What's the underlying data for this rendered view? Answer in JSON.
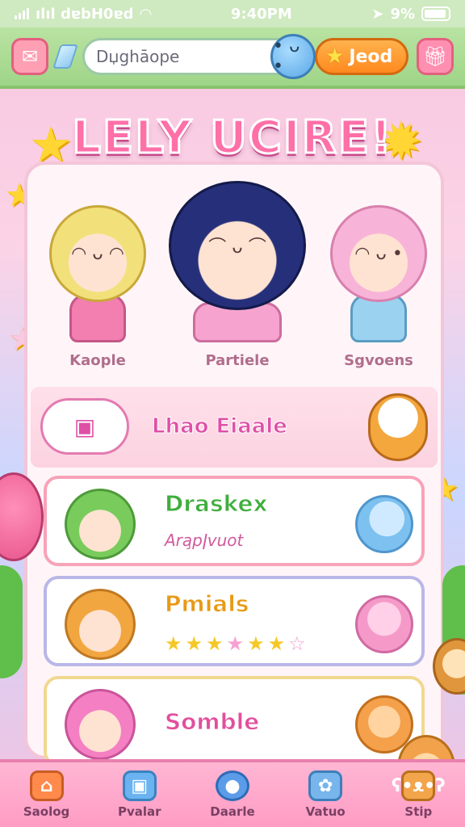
{
  "status_bar": {
    "carrier": "ılıl dɐbH0ɐd",
    "time": "9:40PM",
    "battery_percent": "9%",
    "icons": [
      "signal-icon",
      "wifi-icon",
      "location-icon",
      "battery-icon"
    ]
  },
  "top_bar": {
    "search_value": "Dџghāope",
    "coin_button_label": "Jeod",
    "left_button_icon": "envelope-icon",
    "right_button_icon": "gift-icon",
    "gem_icon": "gem-icon",
    "mascot_icon": "blob-mascot-icon"
  },
  "banner_title": "LELY UCIRE!",
  "featured_characters": [
    {
      "name": "Kaople",
      "hair": "#f2e07a",
      "outfit": "#f27fb0"
    },
    {
      "name": "Partiele",
      "hair": "#26307a",
      "outfit": "#f6a4cf"
    },
    {
      "name": "Sgvoens",
      "hair": "#f7b4d8",
      "outfit": "#9bd2f0"
    }
  ],
  "feature_banner": {
    "label": "Lhao Eiaale",
    "icon": "cloud-gift-icon",
    "mascot": "bear-mascot-icon"
  },
  "cards": [
    {
      "title": "Draskex",
      "subtitle": "Ara̧pǀvuot",
      "title_color": "#3fae3c",
      "border": "#f7a3b8",
      "avatar_hair": "#79cc5c",
      "decor": "#7cc1f0"
    },
    {
      "title": "Pmials",
      "title_color": "#e89a16",
      "border": "#b9b7e8",
      "avatar_hair": "#f2a640",
      "decor": "#f59ac8",
      "rating": 6
    },
    {
      "title": "Somble",
      "title_color": "#e24f9c",
      "border": "#f1d890",
      "avatar_hair": "#f47fc2",
      "decor": "#f5a04a"
    }
  ],
  "tabs": [
    {
      "label": "Saolog",
      "icon": "house-icon",
      "color": "#ff8a4c"
    },
    {
      "label": "Pvalar",
      "icon": "box-icon",
      "color": "#6bb3f0"
    },
    {
      "label": "Daarle",
      "icon": "blob-icon",
      "color": "#5b9ce8"
    },
    {
      "label": "Vatuo",
      "icon": "paw-icon",
      "color": "#77b5ec"
    },
    {
      "label": "Stip",
      "icon": "bear-icon",
      "color": "#f3a54c"
    }
  ],
  "colors": {
    "top_bar": "#a8dc90",
    "tab_bar": "#ffa8cb",
    "title": "#ff6fa8"
  }
}
